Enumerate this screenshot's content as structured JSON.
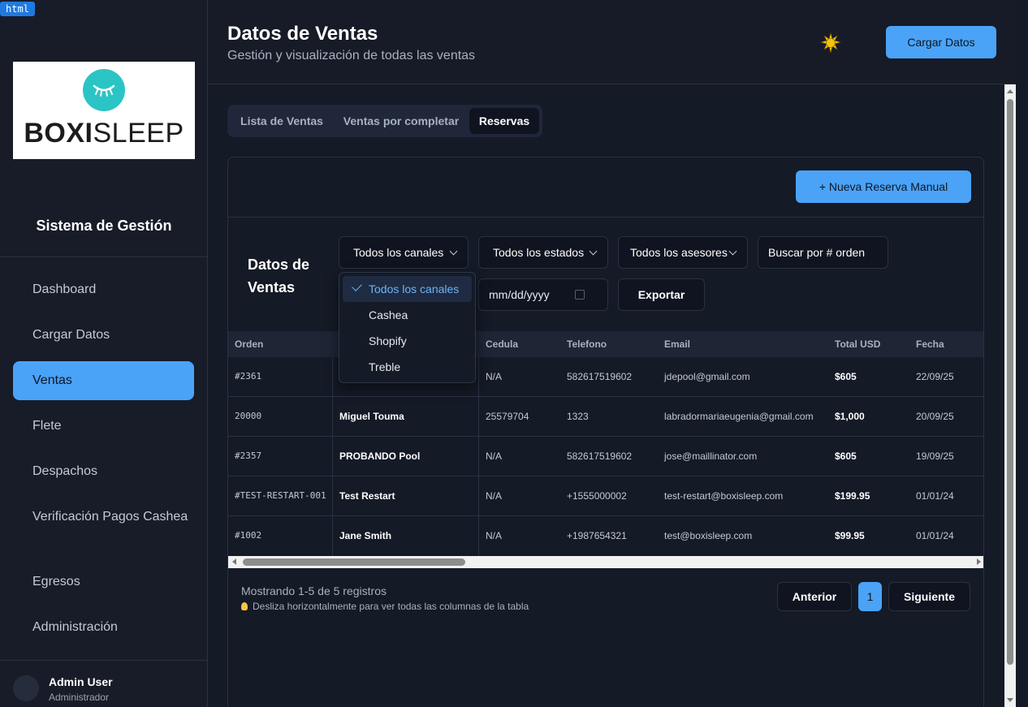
{
  "badge": "html",
  "sidebar": {
    "logo": {
      "brand_bold": "BOXI",
      "brand_light": "SLEEP",
      "circle_color": "#2bc4c4"
    },
    "system_title": "Sistema de Gestión",
    "items": [
      {
        "label": "Dashboard",
        "active": false
      },
      {
        "label": "Cargar Datos",
        "active": false
      },
      {
        "label": "Ventas",
        "active": true
      },
      {
        "label": "Flete",
        "active": false
      },
      {
        "label": "Despachos",
        "active": false
      },
      {
        "label": "Verificación Pagos Cashea",
        "active": false
      },
      {
        "label": "Egresos",
        "active": false
      },
      {
        "label": "Administración",
        "active": false
      }
    ],
    "user": {
      "name": "Admin User",
      "role": "Administrador"
    }
  },
  "header": {
    "title": "Datos de Ventas",
    "subtitle": "Gestión y visualización de todas las ventas",
    "theme_icon": "sun-icon",
    "load_button": "Cargar Datos"
  },
  "tabs": [
    {
      "label": "Lista de Ventas",
      "active": false
    },
    {
      "label": "Ventas por completar",
      "active": false
    },
    {
      "label": "Reservas",
      "active": true
    }
  ],
  "card": {
    "new_reservation_button": "+ Nueva Reserva Manual",
    "title": "Datos de Ventas",
    "filters": {
      "channel": "Todos los canales",
      "status": "Todos los estados",
      "advisor": "Todos los asesores",
      "search_placeholder": "Buscar por # orden",
      "date_placeholder": "mm/dd/yyyy",
      "export_button": "Exportar"
    },
    "channel_dropdown": {
      "options": [
        "Todos los canales",
        "Cashea",
        "Shopify",
        "Treble"
      ],
      "selected": "Todos los canales"
    },
    "table": {
      "columns": [
        "Orden",
        "",
        "Cedula",
        "Telefono",
        "Email",
        "Total USD",
        "Fecha"
      ],
      "rows": [
        {
          "orden": "#2361",
          "cliente": "",
          "cedula": "N/A",
          "telefono": "582617519602",
          "email": "jdepool@gmail.com",
          "total": "$605",
          "fecha": "22/09/25"
        },
        {
          "orden": "20000",
          "cliente": "Miguel Touma",
          "cedula": "25579704",
          "telefono": "1323",
          "email": "labradormariaeugenia@gmail.com",
          "total": "$1,000",
          "fecha": "20/09/25"
        },
        {
          "orden": "#2357",
          "cliente": "PROBANDO Pool",
          "cedula": "N/A",
          "telefono": "582617519602",
          "email": "jose@maillinator.com",
          "total": "$605",
          "fecha": "19/09/25"
        },
        {
          "orden": "#TEST-RESTART-001",
          "cliente": "Test Restart",
          "cedula": "N/A",
          "telefono": "+1555000002",
          "email": "test-restart@boxisleep.com",
          "total": "$199.95",
          "fecha": "01/01/24"
        },
        {
          "orden": "#1002",
          "cliente": "Jane Smith",
          "cedula": "N/A",
          "telefono": "+1987654321",
          "email": "test@boxisleep.com",
          "total": "$99.95",
          "fecha": "01/01/24"
        }
      ]
    },
    "pagination": {
      "showing": "Mostrando 1-5 de 5 registros",
      "hint": "Desliza horizontalmente para ver todas las columnas de la tabla",
      "prev": "Anterior",
      "page": "1",
      "next": "Siguiente"
    }
  },
  "colors": {
    "accent": "#4aa3f7",
    "background": "#141a26",
    "sidebar": "#171c28"
  }
}
